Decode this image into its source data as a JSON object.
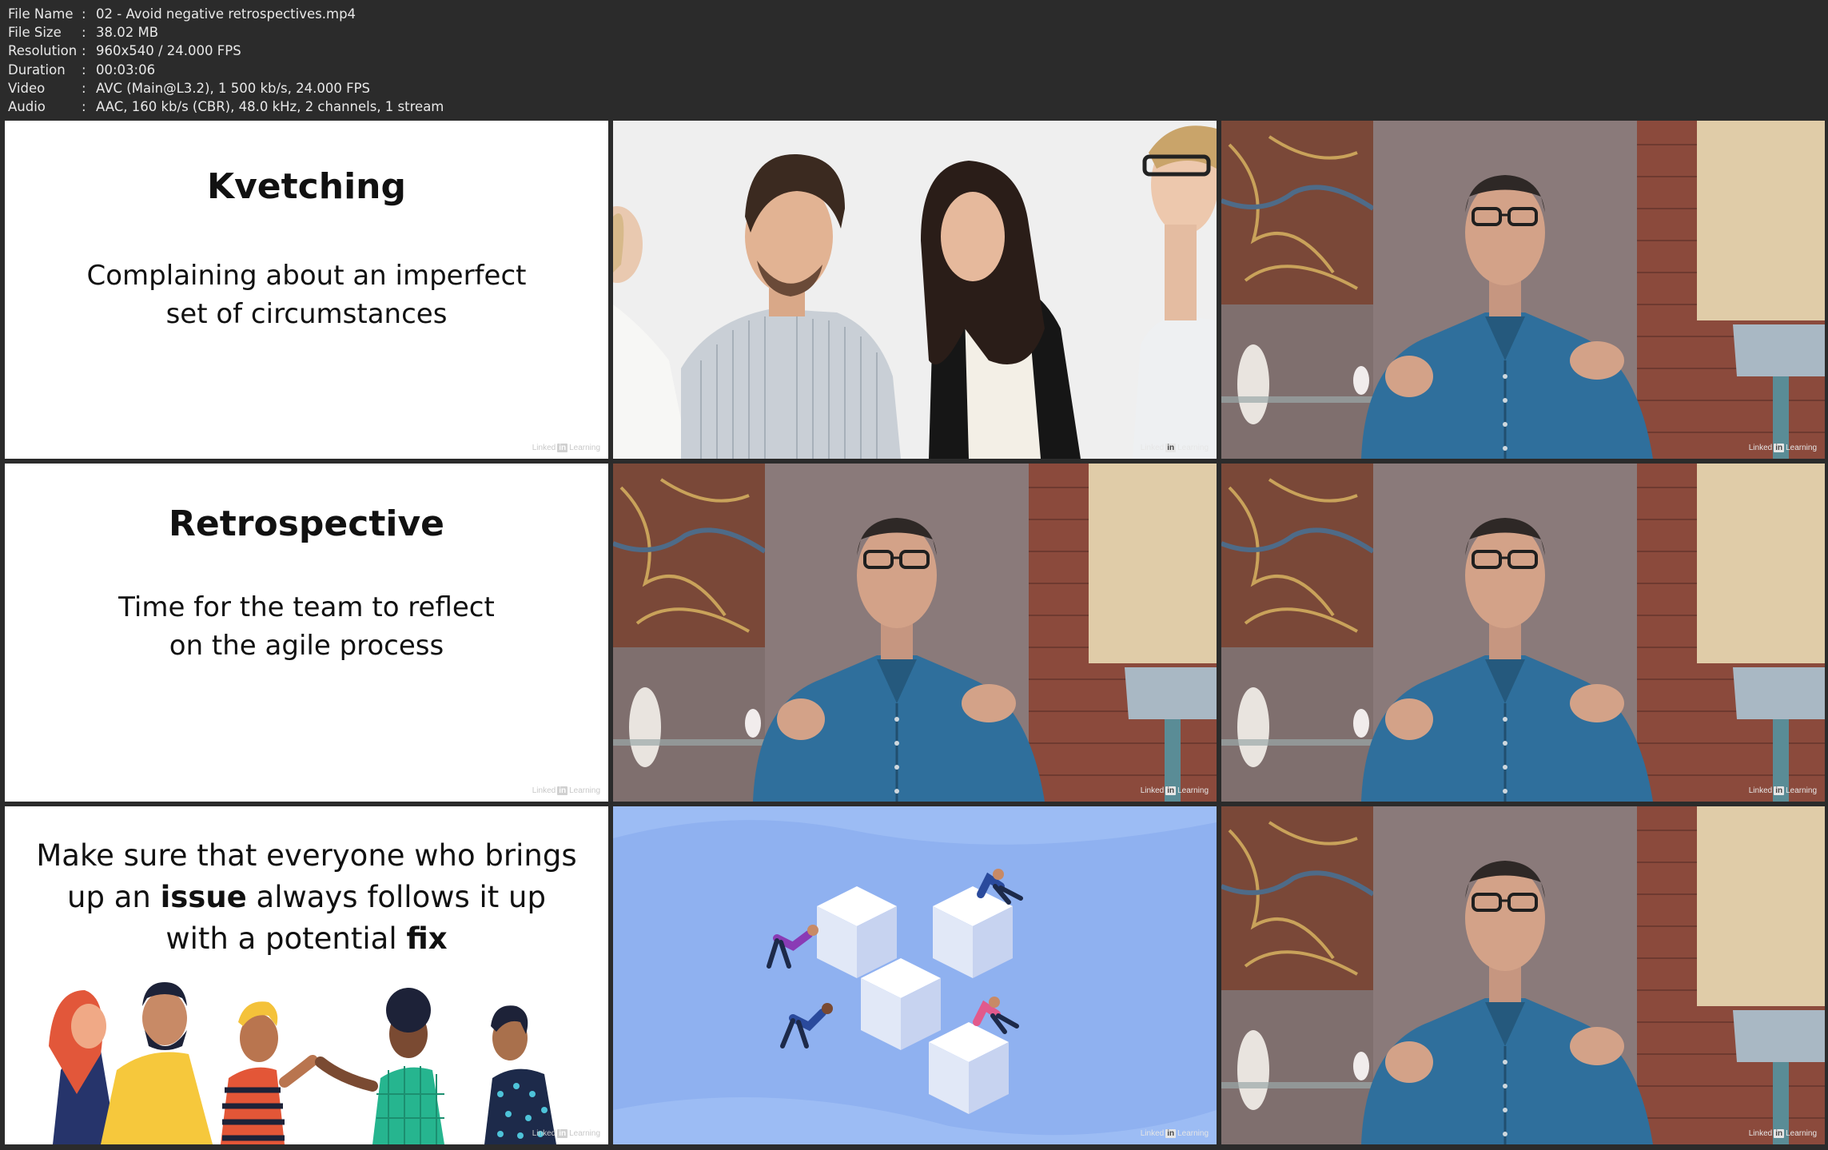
{
  "file_info": [
    {
      "key": "File Name",
      "value": "02 - Avoid negative retrospectives.mp4"
    },
    {
      "key": "File Size",
      "value": "38.02 MB"
    },
    {
      "key": "Resolution",
      "value": "960x540 / 24.000 FPS"
    },
    {
      "key": "Duration",
      "value": "00:03:06"
    },
    {
      "key": "Video",
      "value": "AVC (Main@L3.2), 1 500 kb/s, 24.000 FPS"
    },
    {
      "key": "Audio",
      "value": "AAC, 160 kb/s (CBR), 48.0 kHz, 2 channels, 1 stream"
    }
  ],
  "separator": ":",
  "watermark": {
    "brand_left": "Linked",
    "brand_box": "in",
    "brand_right": "Learning"
  },
  "thumbnails": {
    "slide1": {
      "title": "Kvetching",
      "body_line1": "Complaining about an imperfect",
      "body_line2": "set of circumstances"
    },
    "slide2": {
      "title": "Retrospective",
      "body_line1": "Time for the team to reflect",
      "body_line2": "on the agile process"
    },
    "slide3": {
      "line1": "Make sure that everyone who brings",
      "line2_pre": "up an ",
      "line2_bold": "issue",
      "line2_post": " always follows it up",
      "line3_pre": "with a potential ",
      "line3_bold": "fix"
    },
    "photo_group_scene": "four colleagues talking",
    "presenter_scene": "presenter in blue shirt",
    "illustration_scene": "people pushing cubes"
  },
  "colors": {
    "background": "#2b2b2b",
    "info_text": "#e8e8e8",
    "slide_bg": "#ffffff",
    "shirt_blue": "#2f6f9c",
    "illustration_bg": "#8fb1f0"
  }
}
